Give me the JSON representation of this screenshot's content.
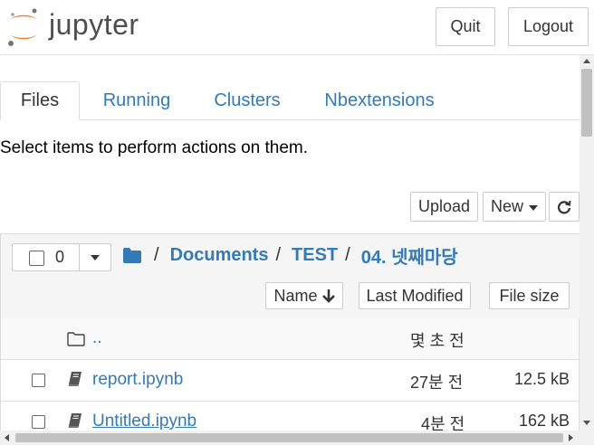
{
  "header": {
    "logo_text": "jupyter",
    "quit_label": "Quit",
    "logout_label": "Logout"
  },
  "tabs": [
    {
      "label": "Files",
      "active": true
    },
    {
      "label": "Running"
    },
    {
      "label": "Clusters"
    },
    {
      "label": "Nbextensions"
    }
  ],
  "helper_text": "Select items to perform actions on them.",
  "toolbar": {
    "upload_label": "Upload",
    "new_label": "New"
  },
  "selector": {
    "count": "0"
  },
  "breadcrumb": {
    "root_sep": "/",
    "items": [
      "Documents",
      "TEST",
      "04. 넷째마당"
    ]
  },
  "sort": {
    "name": "Name",
    "modified": "Last Modified",
    "size": "File size"
  },
  "rows": [
    {
      "name": "..",
      "modified": "몇 초 전",
      "size": ""
    },
    {
      "name": "report.ipynb",
      "modified": "27분 전",
      "size": "12.5 kB"
    },
    {
      "name": "Untitled.ipynb",
      "modified": "4분 전",
      "size": "162 kB"
    }
  ],
  "colors": {
    "link": "#337ab7",
    "logo_orange": "#f37726"
  }
}
